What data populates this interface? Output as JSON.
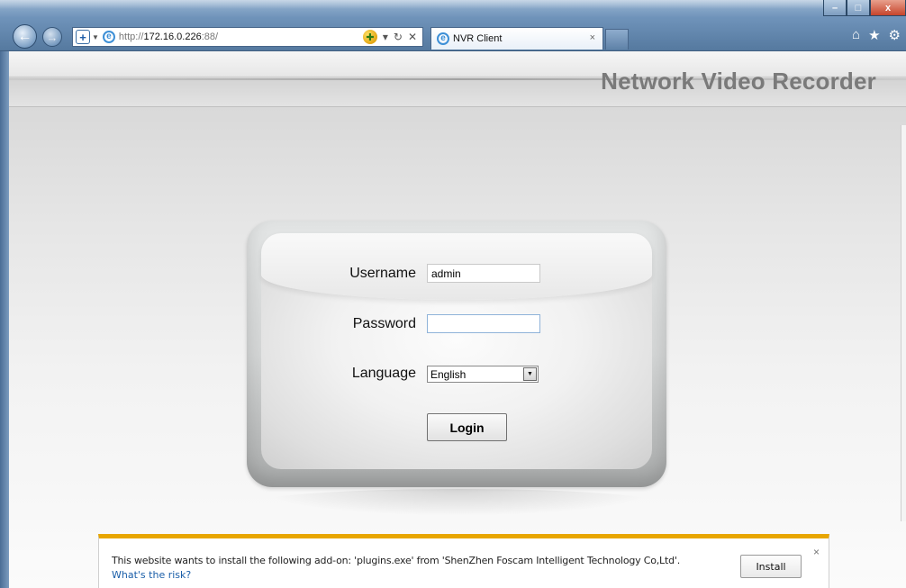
{
  "browser": {
    "window_buttons": {
      "minimize": "–",
      "maximize": "□",
      "close": "x"
    },
    "address": {
      "url_prefix": "http://",
      "url_host": "172.16.0.226",
      "url_port": ":88/",
      "compat_glyph": "✚",
      "tools": {
        "dropdown": "▾",
        "refresh": "↻",
        "stop": "✕"
      }
    },
    "tab": {
      "title": "NVR Client",
      "close": "×"
    },
    "toolbar_icons": {
      "home": "⌂",
      "favorites": "★",
      "settings": "⚙"
    }
  },
  "page": {
    "title": "Network Video Recorder"
  },
  "login": {
    "username_label": "Username",
    "username_value": "admin",
    "password_label": "Password",
    "password_value": "",
    "language_label": "Language",
    "language_value": "English",
    "language_dropdown_glyph": "▼",
    "login_button": "Login"
  },
  "notification": {
    "message": "This website wants to install the following add-on: 'plugins.exe' from 'ShenZhen Foscam Intelligent Technology Co,Ltd'.",
    "risk_link": "What's the risk?",
    "install_button": "Install",
    "close": "×",
    "accent_color": "#e8a600"
  }
}
